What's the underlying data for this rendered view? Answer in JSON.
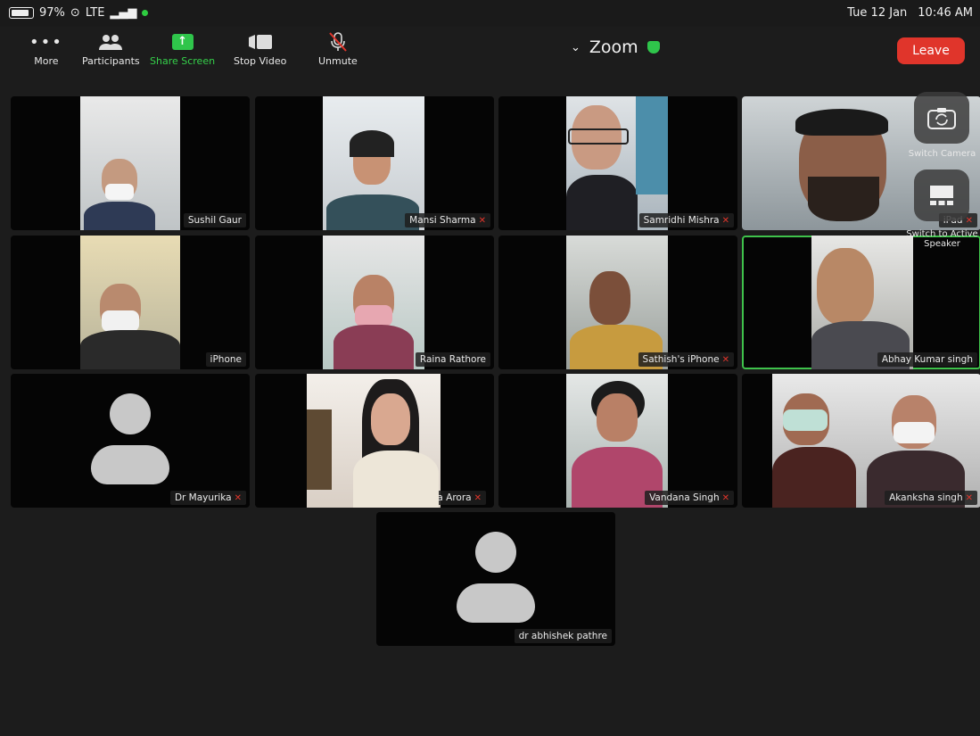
{
  "status": {
    "battery": "97%",
    "network": "LTE",
    "time": "10:46 AM",
    "date": "Tue 12 Jan"
  },
  "toolbar": {
    "more": "More",
    "participants": "Participants",
    "share_screen": "Share Screen",
    "stop_video": "Stop Video",
    "unmute": "Unmute",
    "title": "Zoom",
    "leave": "Leave"
  },
  "floating": {
    "switch_camera": "Switch Camera",
    "switch_active": "Switch to Active Speaker",
    "ipad_label": "iPad"
  },
  "participants": [
    {
      "name": "Sushil Gaur",
      "muted": false
    },
    {
      "name": "Mansi Sharma",
      "muted": true
    },
    {
      "name": "Samridhi Mishra",
      "muted": true
    },
    {
      "name": "iPad",
      "muted": true
    },
    {
      "name": "iPhone",
      "muted": false
    },
    {
      "name": "Raina Rathore",
      "muted": false
    },
    {
      "name": "Sathish's iPhone",
      "muted": true
    },
    {
      "name": "Abhay Kumar singh",
      "muted": false
    },
    {
      "name": "Dr Mayurika",
      "muted": true
    },
    {
      "name": "Udita Arora",
      "muted": true
    },
    {
      "name": "Vandana Singh",
      "muted": true
    },
    {
      "name": "Akanksha singh",
      "muted": true
    },
    {
      "name": "dr abhishek pathre",
      "muted": false
    }
  ],
  "colors": {
    "leave": "#e0352b",
    "share": "#2fc54b",
    "active_speaker": "#3fc24b"
  }
}
